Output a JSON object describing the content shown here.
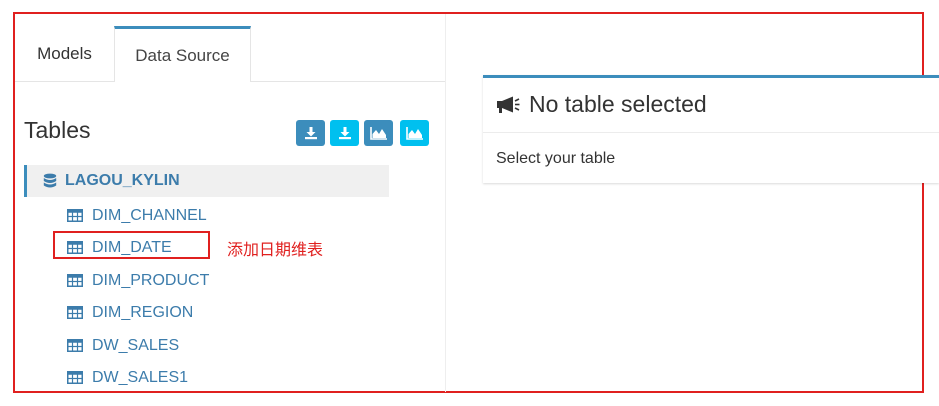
{
  "tabs": [
    {
      "label": "Models",
      "active": false
    },
    {
      "label": "Data Source",
      "active": true
    }
  ],
  "tables_panel": {
    "title": "Tables",
    "toolbar": [
      {
        "icon": "download-icon",
        "color": "#3c8dbc"
      },
      {
        "icon": "download-icon",
        "color": "#00c0ef"
      },
      {
        "icon": "area-chart-icon",
        "color": "#3c8dbc"
      },
      {
        "icon": "area-chart-icon",
        "color": "#00c0ef"
      }
    ],
    "database": {
      "icon": "database-icon",
      "name": "LAGOU_KYLIN"
    },
    "tables": [
      "DIM_CHANNEL",
      "DIM_DATE",
      "DIM_PRODUCT",
      "DIM_REGION",
      "DW_SALES",
      "DW_SALES1"
    ]
  },
  "annotation": {
    "text": "添加日期维表",
    "color": "#e0201f"
  },
  "detail": {
    "icon": "megaphone-icon",
    "title": "No table selected",
    "body": "Select your table"
  },
  "colors": {
    "accent": "#3c8dbc",
    "aqua": "#00c0ef",
    "link": "#3c7cab",
    "annotation": "#e0201f"
  }
}
